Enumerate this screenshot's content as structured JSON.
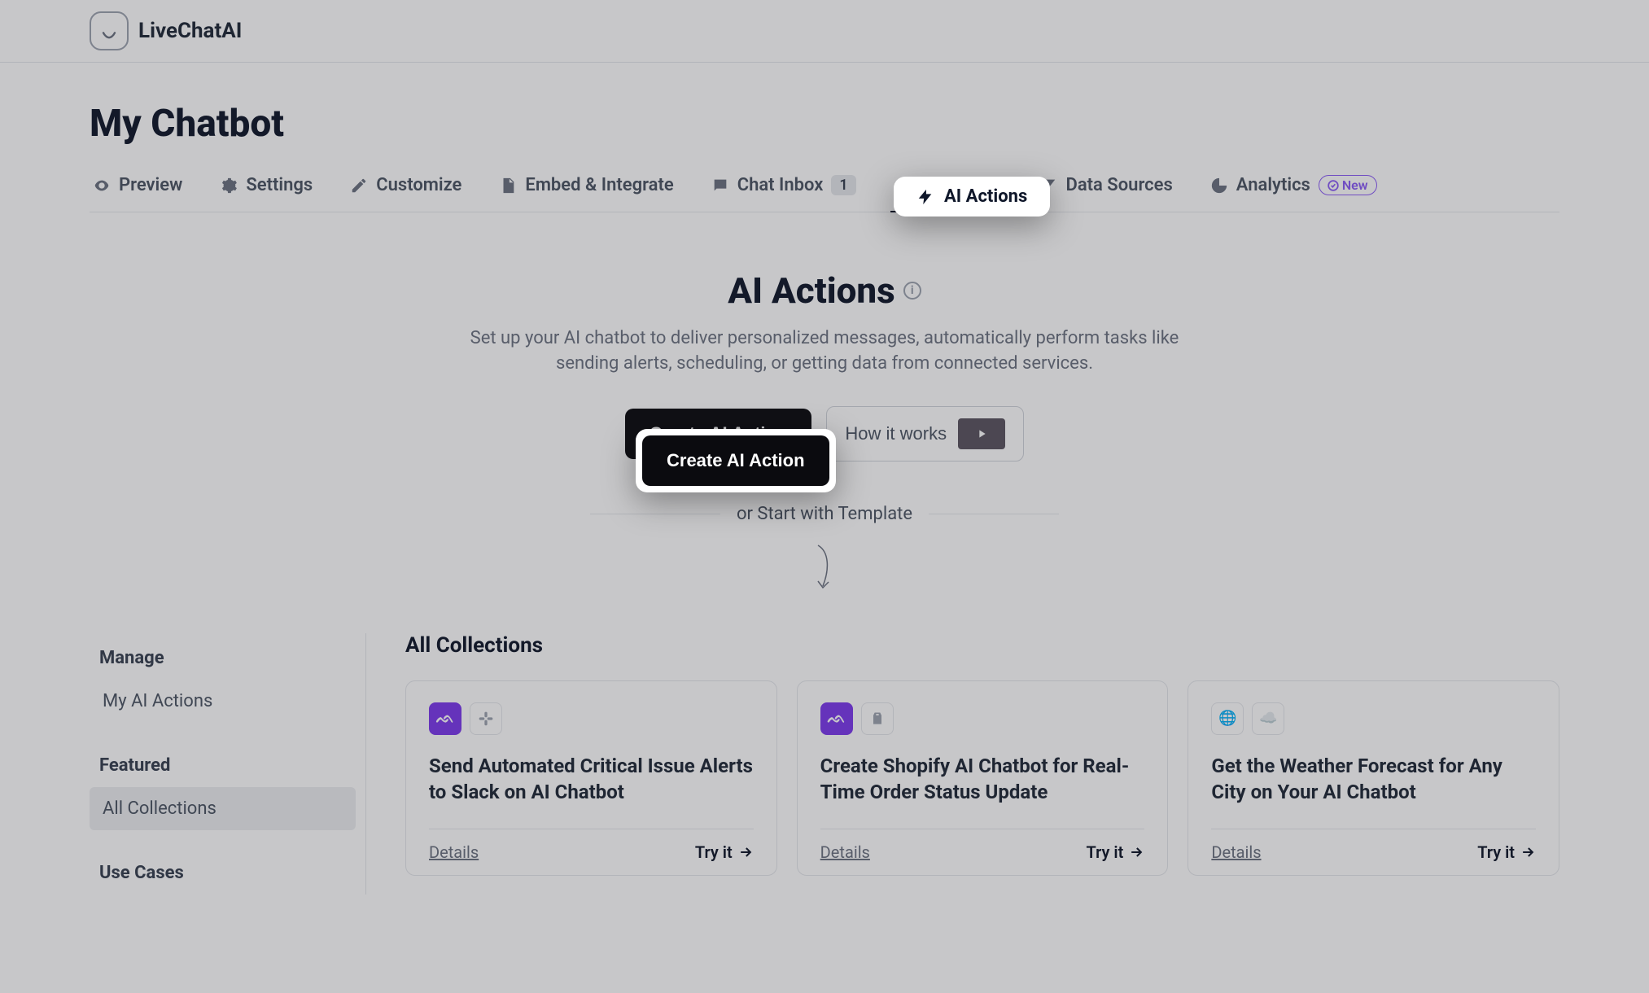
{
  "brand": "LiveChatAI",
  "page_title": "My Chatbot",
  "tabs": {
    "preview": "Preview",
    "settings": "Settings",
    "customize": "Customize",
    "embed": "Embed & Integrate",
    "chat_inbox": "Chat Inbox",
    "chat_inbox_count": "1",
    "ai_actions": "AI Actions",
    "data_sources": "Data Sources",
    "analytics": "Analytics",
    "new_badge": "New"
  },
  "hero": {
    "title": "AI Actions",
    "description": "Set up your AI chatbot to deliver personalized messages, automatically perform tasks like sending alerts, scheduling, or getting data from connected services.",
    "create_btn": "Create AI Action",
    "how_it_works": "How it works",
    "or_template": "or Start with Template"
  },
  "sidebar": {
    "manage_heading": "Manage",
    "my_ai_actions": "My AI Actions",
    "featured_heading": "Featured",
    "all_collections": "All Collections",
    "use_cases_heading": "Use Cases"
  },
  "main": {
    "all_collections_title": "All Collections",
    "details_label": "Details",
    "tryit_label": "Try it",
    "cards": [
      {
        "title": "Send Automated Critical Issue Alerts to Slack on AI Chatbot"
      },
      {
        "title": "Create Shopify AI Chatbot for Real-Time Order Status Update"
      },
      {
        "title": "Get the Weather Forecast for Any City on Your AI Chatbot"
      }
    ]
  }
}
